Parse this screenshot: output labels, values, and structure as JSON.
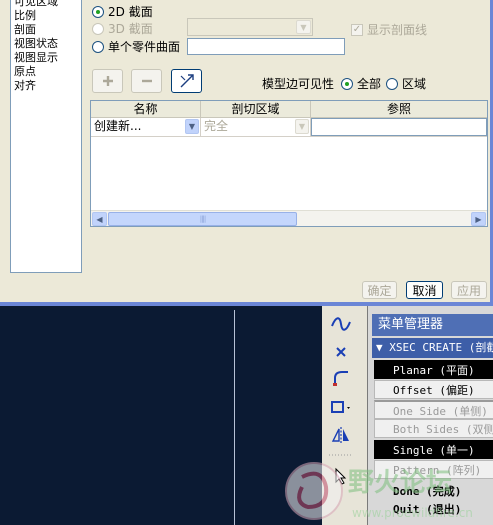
{
  "tree": {
    "items": [
      "可见区域",
      "比例",
      "剖面",
      "视图状态",
      "视图显示",
      "原点",
      "对齐"
    ]
  },
  "section": {
    "radio_2d": "2D 截面",
    "radio_3d": "3D 截面",
    "radio_part": "单个零件曲面",
    "show_hatch": "显示剖面线",
    "visibility_label": "模型边可见性",
    "vis_all": "全部",
    "vis_area": "区域"
  },
  "toolbar": {
    "add_icon": "plus-icon",
    "remove_icon": "minus-icon",
    "arrow_icon": "arrow-pick-icon"
  },
  "table": {
    "headers": [
      "名称",
      "剖切区域",
      "参照"
    ],
    "row": {
      "name": "创建新...",
      "region": "完全",
      "ref": ""
    }
  },
  "buttons": {
    "ok": "确定",
    "cancel": "取消",
    "apply": "应用"
  },
  "menu": {
    "title": "菜单管理器",
    "header": "XSEC CREATE (剖截",
    "items": [
      {
        "label": "Planar (平面)",
        "state": "selected"
      },
      {
        "label": "Offset (偏距)",
        "state": "normal"
      },
      {
        "label": "One Side (单侧)",
        "state": "disabled"
      },
      {
        "label": "Both Sides (双侧)",
        "state": "disabled"
      },
      {
        "label": "Single (单一)",
        "state": "selected"
      },
      {
        "label": "Pattern (阵列)",
        "state": "disabled"
      },
      {
        "label": "Done (完成)",
        "state": "plain"
      },
      {
        "label": "Quit (退出)",
        "state": "plain"
      }
    ]
  },
  "colors": {
    "graphics_bg": "#0b1a33",
    "menu_title_bg": "#4f6fb5",
    "dialog_bg": "#ece9d8"
  },
  "watermark": {
    "text_cn": "野火论坛",
    "text_url": "www.proewildfire.cn"
  }
}
